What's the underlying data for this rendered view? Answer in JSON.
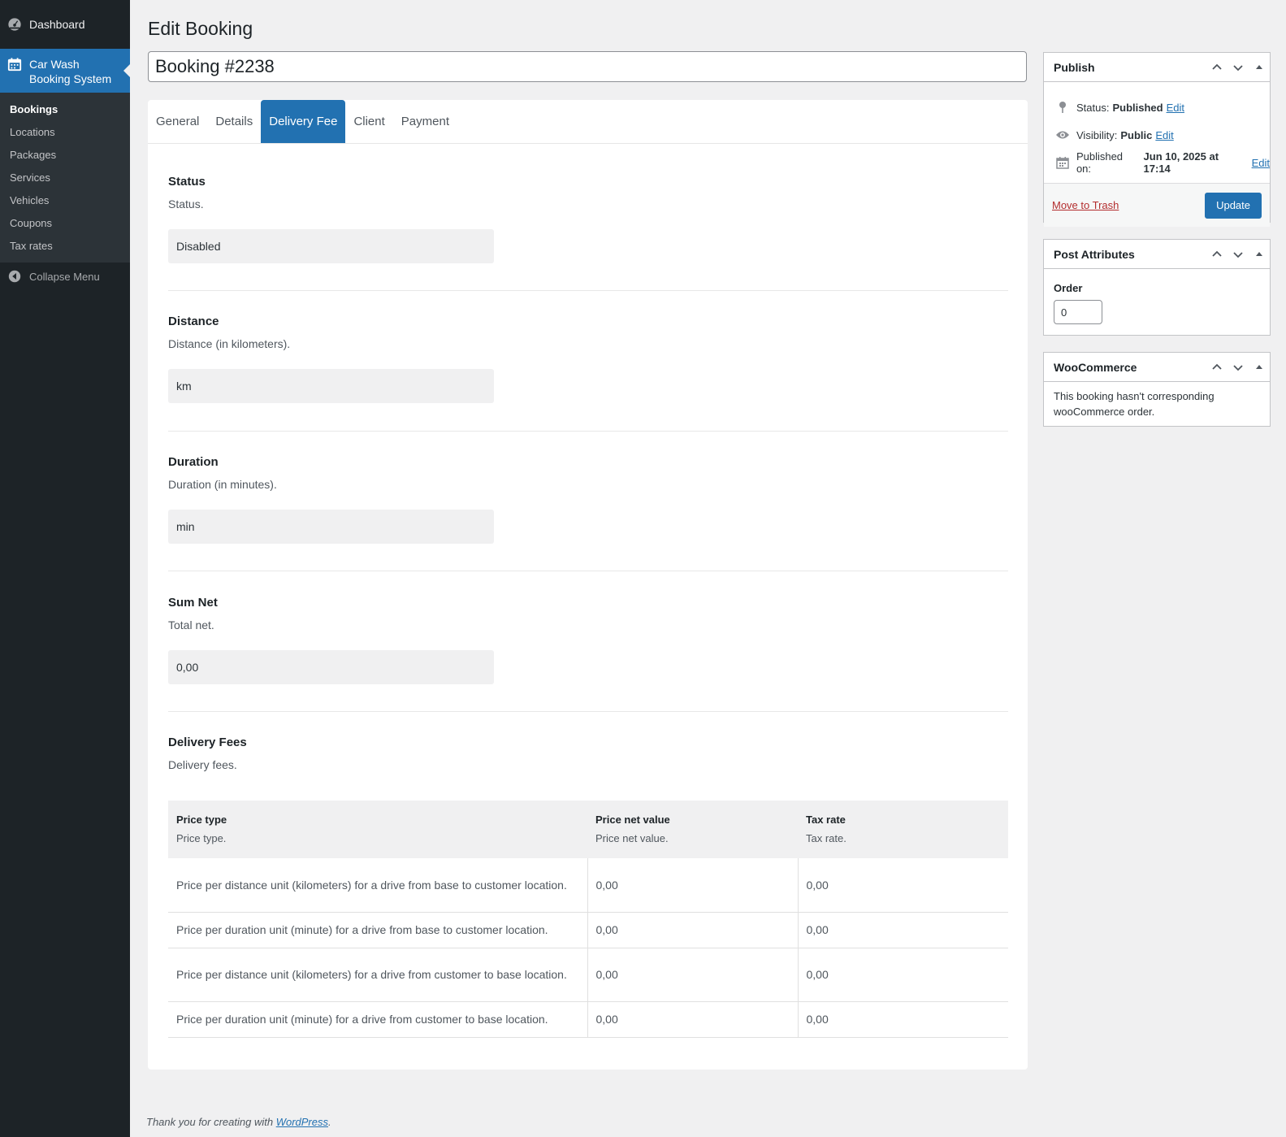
{
  "sidebar": {
    "dashboard": "Dashboard",
    "active_menu": "Car Wash Booking System",
    "active_menu_line1": "Car Wash",
    "active_menu_line2": "Booking System",
    "items": [
      {
        "label": "Bookings",
        "current": true
      },
      {
        "label": "Locations"
      },
      {
        "label": "Packages"
      },
      {
        "label": "Services"
      },
      {
        "label": "Vehicles"
      },
      {
        "label": "Coupons"
      },
      {
        "label": "Tax rates"
      }
    ],
    "collapse": "Collapse Menu"
  },
  "header": {
    "page_title": "Edit Booking",
    "post_title": "Booking #2238"
  },
  "tabs": [
    {
      "label": "General"
    },
    {
      "label": "Details"
    },
    {
      "label": "Delivery Fee",
      "active": true
    },
    {
      "label": "Client"
    },
    {
      "label": "Payment"
    }
  ],
  "fields": {
    "status": {
      "title": "Status",
      "description": "Status.",
      "value": "Disabled"
    },
    "distance": {
      "title": "Distance",
      "description": "Distance (in kilometers).",
      "value": "km"
    },
    "duration": {
      "title": "Duration",
      "description": "Duration (in minutes).",
      "value": "min"
    },
    "sum_net": {
      "title": "Sum Net",
      "description": "Total net.",
      "value": "0,00"
    },
    "delivery_fees": {
      "title": "Delivery Fees",
      "description": "Delivery fees."
    }
  },
  "fees_table": {
    "columns": [
      {
        "title": "Price type",
        "description": "Price type."
      },
      {
        "title": "Price net value",
        "description": "Price net value."
      },
      {
        "title": "Tax rate",
        "description": "Tax rate."
      }
    ],
    "rows": [
      {
        "type": "Price per distance unit (kilometers) for a drive from base to customer location.",
        "net": "0,00",
        "tax": "0,00"
      },
      {
        "type": "Price per duration unit (minute) for a drive from base to customer location.",
        "net": "0,00",
        "tax": "0,00"
      },
      {
        "type": "Price per distance unit (kilometers) for a drive from customer to base location.",
        "net": "0,00",
        "tax": "0,00"
      },
      {
        "type": "Price per duration unit (minute) for a drive from customer to base location.",
        "net": "0,00",
        "tax": "0,00"
      }
    ]
  },
  "publish": {
    "title": "Publish",
    "status_label": "Status:",
    "status_value": "Published",
    "visibility_label": "Visibility:",
    "visibility_value": "Public",
    "published_label": "Published on:",
    "published_value": "Jun 10, 2025 at 17:14",
    "edit": "Edit",
    "trash": "Move to Trash",
    "update": "Update"
  },
  "post_attributes": {
    "title": "Post Attributes",
    "order_label": "Order",
    "order_value": "0"
  },
  "woocommerce": {
    "title": "WooCommerce",
    "message": "This booking hasn't corresponding wooCommerce order."
  },
  "footer": {
    "text": "Thank you for creating with",
    "link": "WordPress",
    "suffix": "."
  },
  "colors": {
    "accent": "#2271b1",
    "sidebar_bg": "#1d2327",
    "submenu_bg": "#2c3338",
    "trash": "#b32d2e"
  }
}
